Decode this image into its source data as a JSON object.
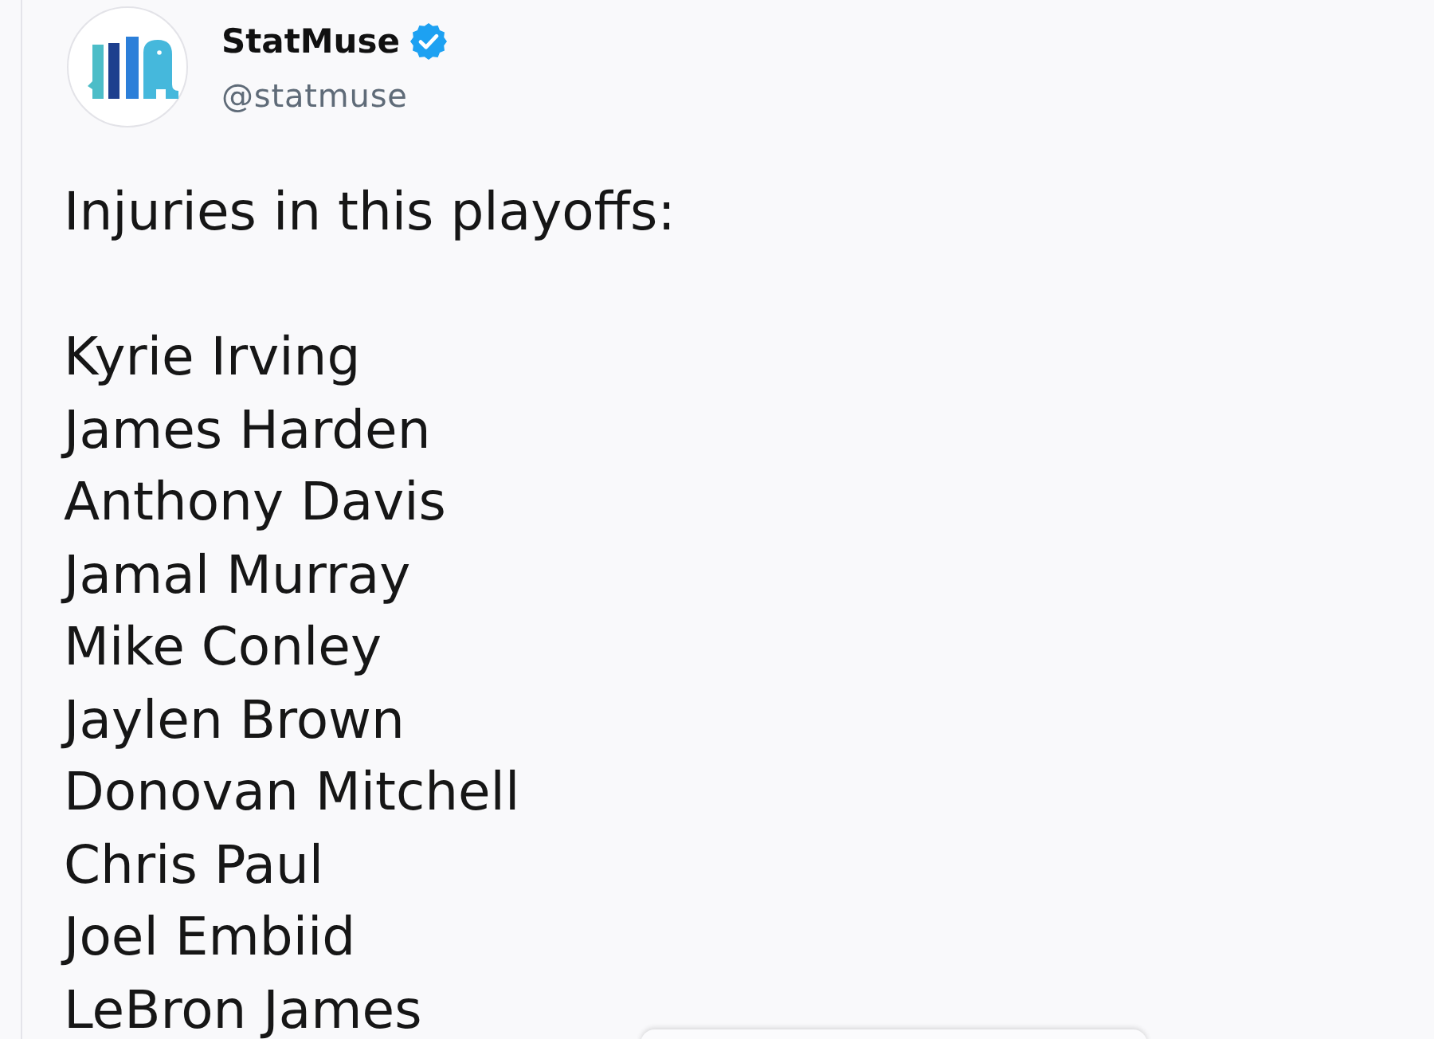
{
  "account": {
    "name": "StatMuse",
    "verified": true,
    "handle": "@statmuse"
  },
  "tweet": {
    "heading": "Injuries in this playoffs:",
    "list": [
      "Kyrie Irving",
      "James Harden",
      "Anthony Davis",
      "Jamal Murray",
      "Mike Conley",
      "Jaylen Brown",
      "Donovan Mitchell",
      "Chris Paul",
      "Joel Embiid",
      "LeBron James"
    ]
  }
}
